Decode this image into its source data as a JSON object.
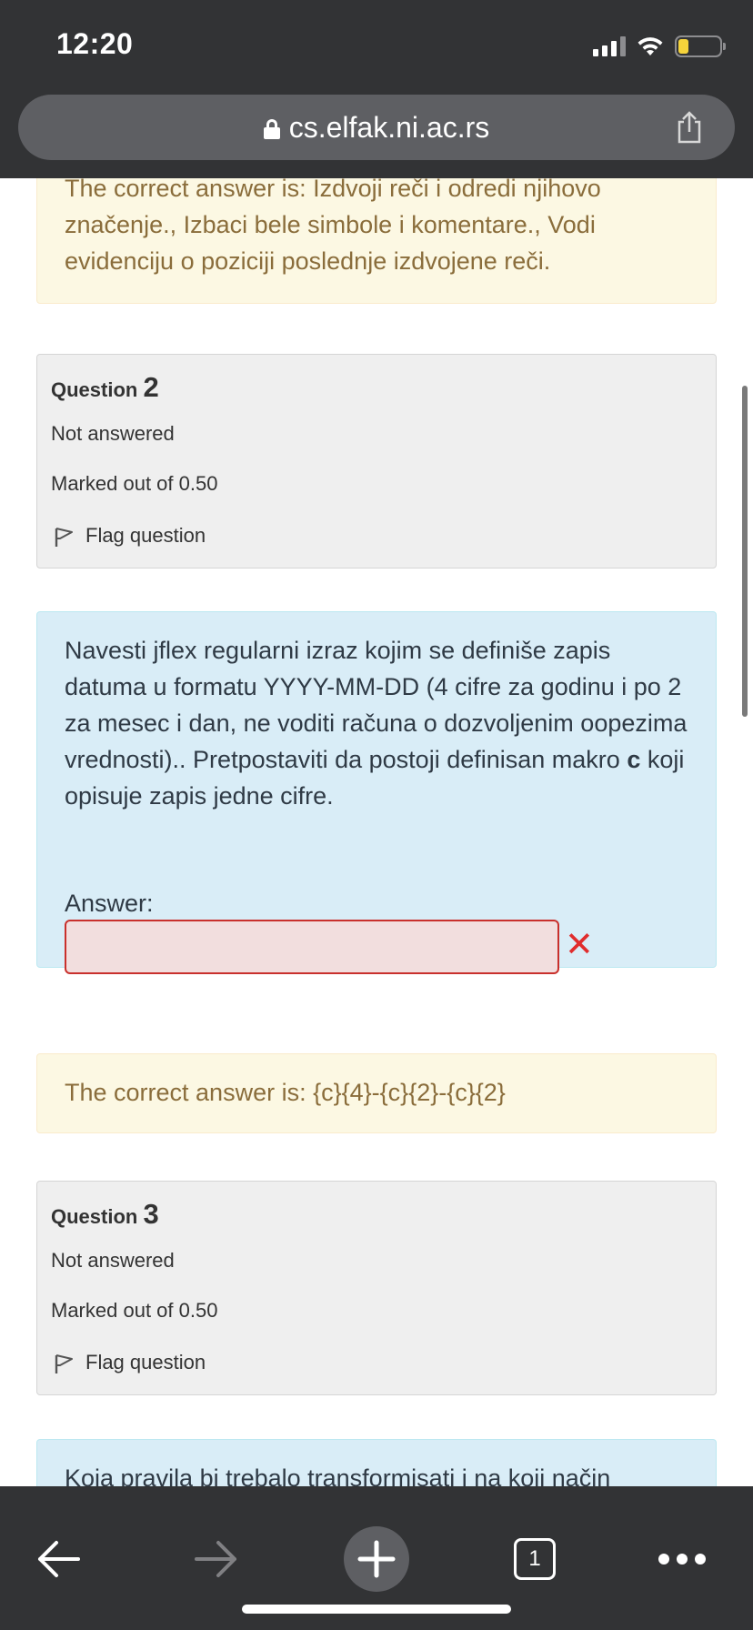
{
  "status_bar": {
    "time": "12:20",
    "signal_icon": "signal-icon",
    "wifi_icon": "wifi-icon",
    "battery_icon": "battery-icon",
    "battery_color": "#f5d33b"
  },
  "browser": {
    "url": "cs.elfak.ni.ac.rs",
    "lock_icon": "lock-icon",
    "share_icon": "share-icon"
  },
  "feedback_top": {
    "text": "The correct answer is: Izdvoji reči i odredi njihovo značenje., Izbaci bele simbole i komentare., Vodi evidenciju o poziciji poslednje izdvojene reči."
  },
  "question2": {
    "title_prefix": "Question",
    "number": "2",
    "state": "Not answered",
    "grade": "Marked out of 0.50",
    "flag_label": "Flag question",
    "text_before_bold": "Navesti jflex regularni izraz kojim se definiše zapis datuma u formatu YYYY-MM-DD (4 cifre za godinu i po 2 za mesec i dan, ne voditi računa o dozvoljenim oopezima vrednosti).. Pretpostaviti da postoji definisan makro ",
    "bold_word": "c",
    "text_after_bold": " koji opisuje zapis jedne cifre.",
    "answer_label": "Answer:",
    "answer_value": "",
    "answer_status_icon": "incorrect-icon",
    "feedback": "The correct answer is: {c}{4}-{c}{2}-{c}{2}"
  },
  "question3": {
    "title_prefix": "Question",
    "number": "3",
    "state": "Not answered",
    "grade": "Marked out of 0.50",
    "flag_label": "Flag question",
    "text_partial": "Koja pravila bi trebalo transformisati i na koji način"
  },
  "toolbar": {
    "back_icon": "back-arrow-icon",
    "forward_icon": "forward-arrow-icon",
    "new_tab_icon": "plus-icon",
    "tabs_count": "1",
    "more_icon": "more-icon"
  },
  "colors": {
    "chrome": "#323335",
    "feedback_bg": "#fcf8e3",
    "feedback_text": "#8a6d3b",
    "info_bg": "#efefef",
    "formulation_bg": "#d9edf7",
    "error": "#e02d2d"
  }
}
